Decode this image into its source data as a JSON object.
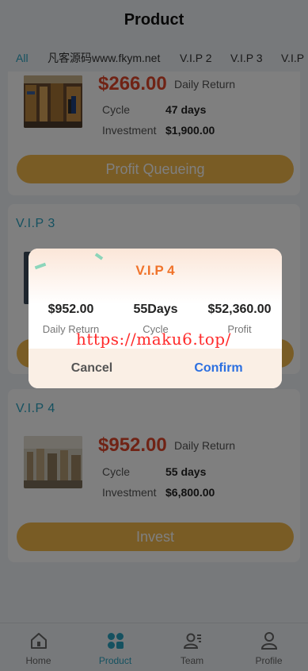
{
  "header": {
    "title": "Product"
  },
  "tabs": [
    {
      "label": "All",
      "active": true
    },
    {
      "label": "凡客源码www.fkym.net",
      "active": false
    },
    {
      "label": "V.I.P 2",
      "active": false
    },
    {
      "label": "V.I.P 3",
      "active": false
    },
    {
      "label": "V.I.P",
      "active": false
    }
  ],
  "products": [
    {
      "title": "",
      "price": "$266.00",
      "daily_label": "Daily Return",
      "cycle_label": "Cycle",
      "cycle_value": "47 days",
      "investment_label": "Investment",
      "investment_value": "$1,900.00",
      "button_label": "Profit Queueing"
    },
    {
      "title": "V.I.P 3"
    },
    {
      "title": "V.I.P 4",
      "price": "$952.00",
      "daily_label": "Daily Return",
      "cycle_label": "Cycle",
      "cycle_value": "55 days",
      "investment_label": "Investment",
      "investment_value": "$6,800.00",
      "button_label": "Invest"
    }
  ],
  "modal": {
    "title": "V.I.P 4",
    "stats": [
      {
        "value": "$952.00",
        "label": "Daily Return"
      },
      {
        "value": "55Days",
        "label": "Cycle"
      },
      {
        "value": "$52,360.00",
        "label": "Profit"
      }
    ],
    "cancel_label": "Cancel",
    "confirm_label": "Confirm"
  },
  "watermark": "https://maku6.top/",
  "nav": [
    {
      "label": "Home",
      "icon": "home-icon",
      "active": false
    },
    {
      "label": "Product",
      "icon": "product-icon",
      "active": true
    },
    {
      "label": "Team",
      "icon": "team-icon",
      "active": false
    },
    {
      "label": "Profile",
      "icon": "profile-icon",
      "active": false
    }
  ],
  "colors": {
    "accent": "#2aa3c1",
    "price": "#e0472b",
    "button": "#f2b84b",
    "modal_title": "#f0732a",
    "confirm": "#2b6fe0"
  }
}
